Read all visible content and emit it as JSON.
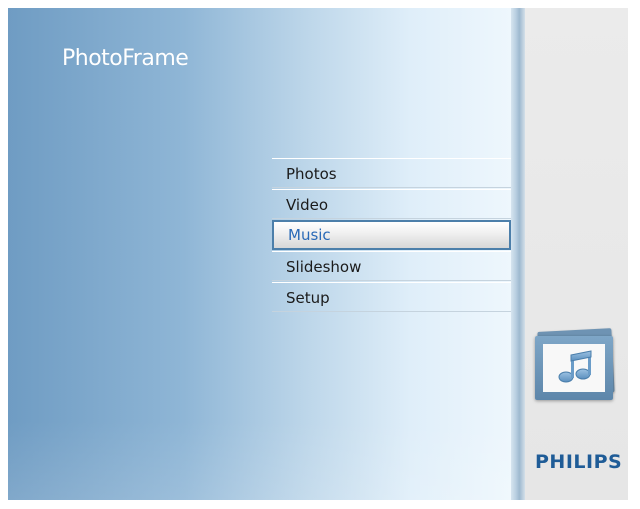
{
  "app_title": "PhotoFrame",
  "menu": {
    "items": [
      {
        "label": "Photos",
        "selected": false
      },
      {
        "label": "Video",
        "selected": false
      },
      {
        "label": "Music",
        "selected": true
      },
      {
        "label": "Slideshow",
        "selected": false
      },
      {
        "label": "Setup",
        "selected": false
      }
    ]
  },
  "sidebar": {
    "icon": "music-notes-icon",
    "brand": "PHILIPS"
  },
  "colors": {
    "brand_blue": "#1f5c97",
    "selected_text": "#2a6ab7",
    "selected_border": "#4c7faa"
  }
}
